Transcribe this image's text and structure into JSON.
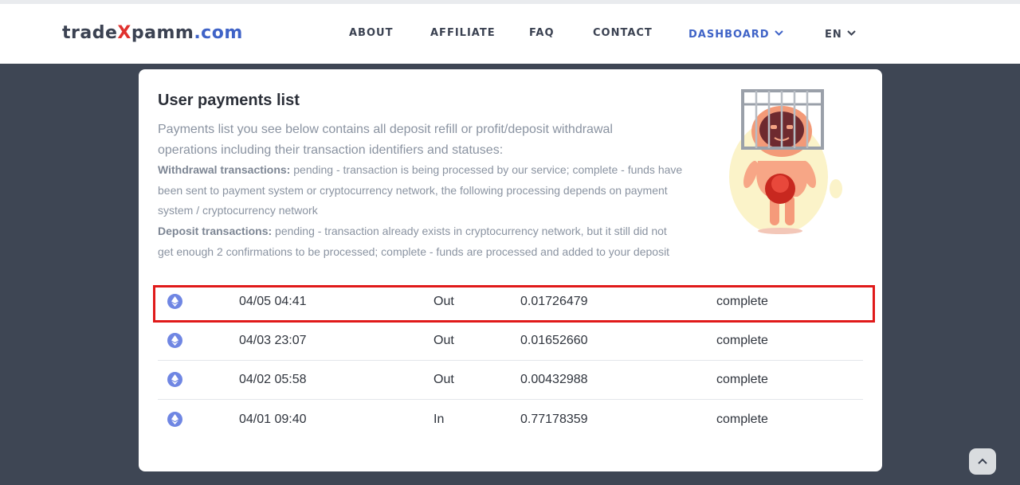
{
  "header": {
    "logo": {
      "part1": "trade",
      "part2": "X",
      "part3": "pamm",
      "part4": ".com"
    },
    "nav": [
      {
        "label": "ABOUT"
      },
      {
        "label": "AFFILIATE"
      },
      {
        "label": "FAQ"
      },
      {
        "label": "CONTACT"
      },
      {
        "label": "DASHBOARD"
      },
      {
        "label": "EN"
      }
    ]
  },
  "main": {
    "title": "User payments list",
    "description": "Payments list you see below contains all deposit refill or profit/deposit withdrawal operations including their transaction identifiers and statuses:",
    "withdrawal_label": "Withdrawal transactions:",
    "withdrawal_text": " pending - transaction is being processed by our service; complete - funds have been sent to payment system or cryptocurrency network, the following processing depends on payment system / cryptocurrency network",
    "deposit_label": "Deposit transactions:",
    "deposit_text": " pending - transaction already exists in cryptocurrency network, but it still did not get enough 2 confirmations to be processed; complete - funds are processed and added to your deposit",
    "payments": [
      {
        "date": "04/05 04:41",
        "direction": "Out",
        "amount": "0.01726479",
        "status": "complete",
        "icon": "ethereum-icon"
      },
      {
        "date": "04/03 23:07",
        "direction": "Out",
        "amount": "0.01652660",
        "status": "complete",
        "icon": "ethereum-icon"
      },
      {
        "date": "04/02 05:58",
        "direction": "Out",
        "amount": "0.00432988",
        "status": "complete",
        "icon": "ethereum-icon"
      },
      {
        "date": "04/01 09:40",
        "direction": "In",
        "amount": "0.77178359",
        "status": "complete",
        "icon": "ethereum-icon"
      }
    ]
  },
  "colors": {
    "page_bg": "#3e4654",
    "accent": "#3f63c7",
    "logo_x": "#e0312e",
    "highlight_border": "#e01a1a",
    "coin": "#6f86e3"
  }
}
